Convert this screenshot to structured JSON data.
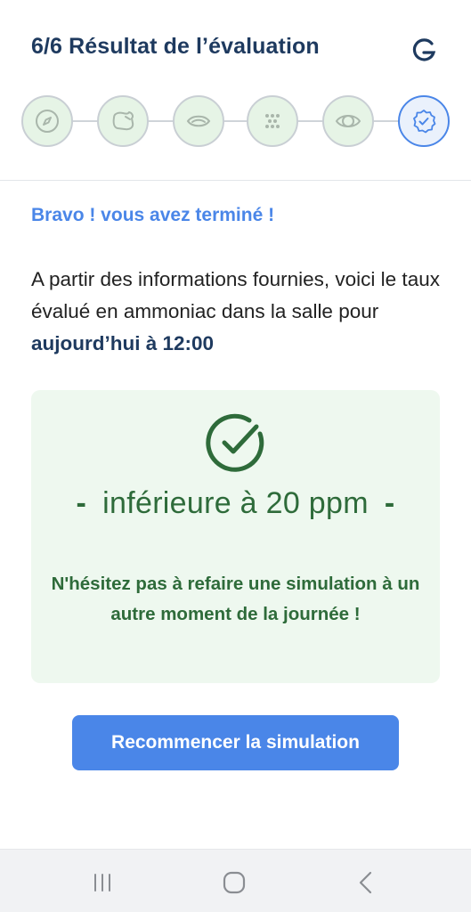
{
  "header": {
    "title": "6/6 Résultat de l’évaluation",
    "reload_icon": "reload-g-icon"
  },
  "steps": {
    "items": [
      {
        "icon": "compass-icon",
        "status": "done"
      },
      {
        "icon": "meat-icon",
        "status": "done"
      },
      {
        "icon": "eye-closed-icon",
        "status": "done"
      },
      {
        "icon": "dots-grid-icon",
        "status": "done"
      },
      {
        "icon": "eye-icon",
        "status": "done"
      },
      {
        "icon": "badge-check-icon",
        "status": "current"
      }
    ]
  },
  "main": {
    "bravo": "Bravo ! vous avez terminé !",
    "description_prefix": "A partir des informations fournies, voici le taux évalué en ammoniac dans la salle pour ",
    "description_time": "aujourd’hui à 12:00",
    "result": {
      "icon": "check-circle-icon",
      "dash": "-",
      "level": "inférieure à 20 ppm",
      "advice": "N'hésitez pas à refaire une simulation à un autre moment de la journée !"
    },
    "restart_label": "Recommencer la simulation"
  },
  "navbar": {
    "items": [
      "recent-apps-icon",
      "home-icon",
      "back-icon"
    ]
  },
  "colors": {
    "primary": "#4a86e8",
    "title": "#1e3a5f",
    "success": "#2e6b3a",
    "success_bg": "#eef8ef"
  }
}
